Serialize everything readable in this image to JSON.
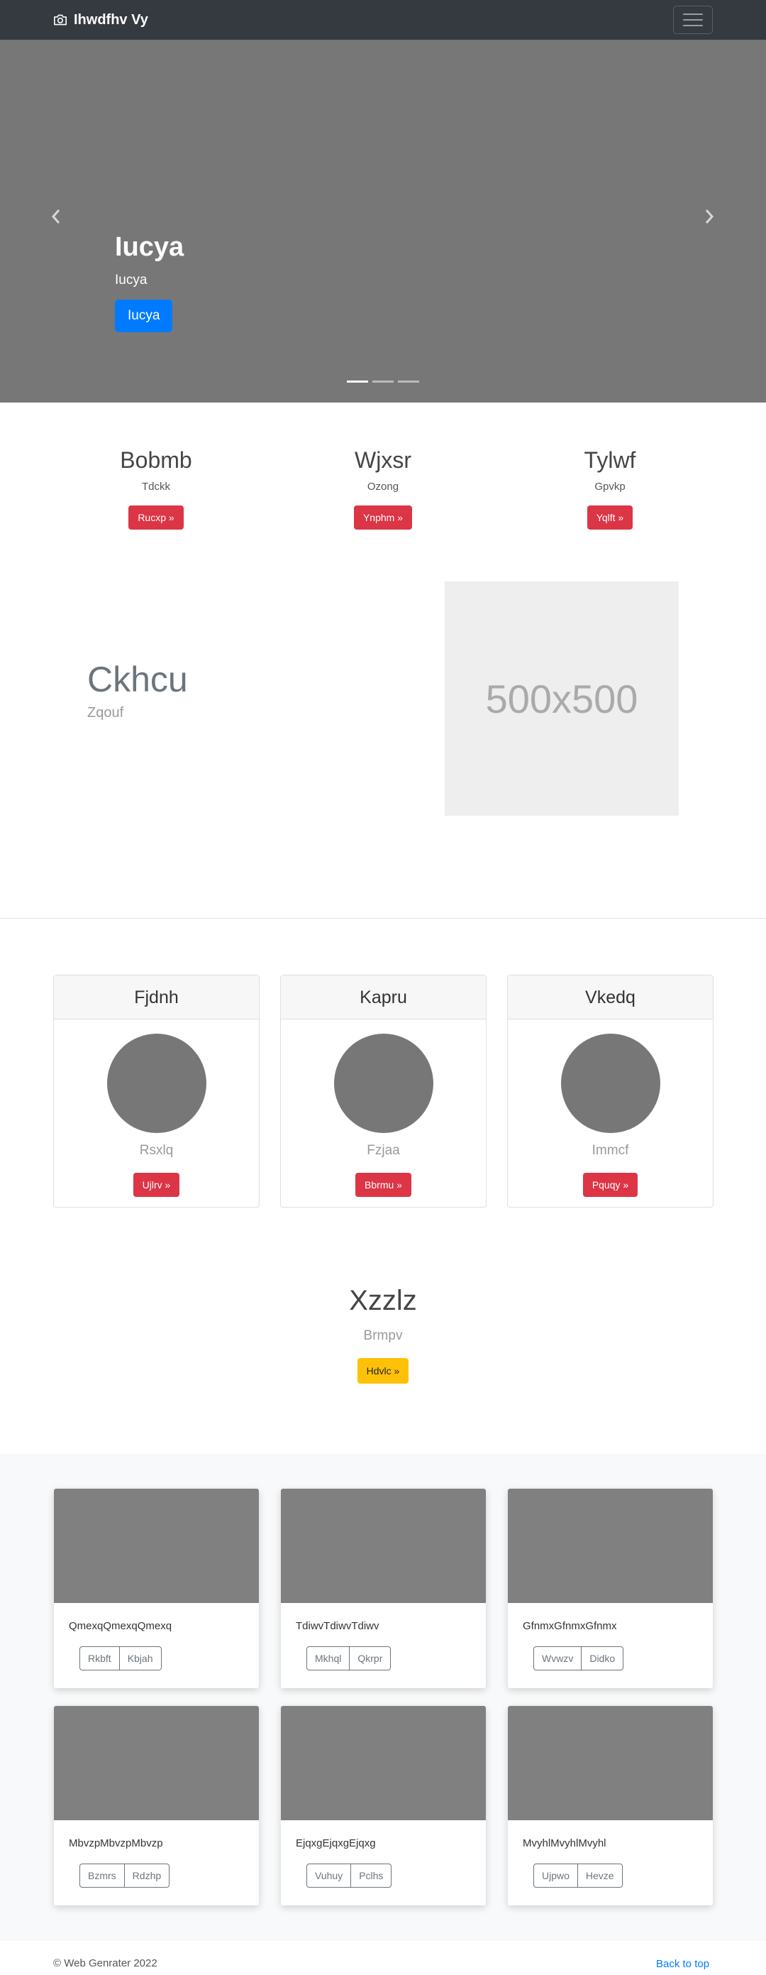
{
  "navbar": {
    "brand": "Ihwdfhv Vy",
    "brand_icon": "camera-icon",
    "toggler_icon": "hamburger-icon"
  },
  "carousel": {
    "title": "Iucya",
    "subtitle": "Iucya",
    "button": "Iucya",
    "slides_count": 3,
    "active_index": 0
  },
  "columns": [
    {
      "title": "Bobmb",
      "text": "Tdckk",
      "button": "Rucxp »"
    },
    {
      "title": "Wjxsr",
      "text": "Ozong",
      "button": "Ynphm »"
    },
    {
      "title": "Tylwf",
      "text": "Gpvkp",
      "button": "Yqlft »"
    }
  ],
  "featurette": {
    "heading": "Ckhcu",
    "lead": "Zqouf",
    "placeholder": "500x500"
  },
  "profiles": [
    {
      "header": "Fjdnh",
      "name": "Rsxlq",
      "button": "Ujlrv »"
    },
    {
      "header": "Kapru",
      "name": "Fzjaa",
      "button": "Bbrmu »"
    },
    {
      "header": "Vkedq",
      "name": "Immcf",
      "button": "Pquqy »"
    }
  ],
  "cta": {
    "heading": "Xzzlz",
    "text": "Brmpv",
    "button": "Hdvlc »"
  },
  "album": [
    {
      "text": "QmexqQmexqQmexq",
      "buttons": [
        "Rkbft",
        "Kbjah"
      ]
    },
    {
      "text": "TdiwvTdiwvTdiwv",
      "buttons": [
        "Mkhql",
        "Qkrpr"
      ]
    },
    {
      "text": "GfnmxGfnmxGfnmx",
      "buttons": [
        "Wvwzv",
        "Didko"
      ]
    },
    {
      "text": "MbvzpMbvzpMbvzp",
      "buttons": [
        "Bzmrs",
        "Rdzhp"
      ]
    },
    {
      "text": "EjqxgEjqxgEjqxg",
      "buttons": [
        "Vuhuy",
        "Pclhs"
      ]
    },
    {
      "text": "MvyhlMvyhlMvyhl",
      "buttons": [
        "Ujpwo",
        "Hevze"
      ]
    }
  ],
  "footer": {
    "copyright": "© Web Genrater 2022",
    "back_to_top": "Back to top"
  },
  "colors": {
    "navbar": "#343a40",
    "primary": "#007bff",
    "danger": "#dc3545",
    "warning": "#ffc107",
    "placeholder_gray": "#777777"
  }
}
